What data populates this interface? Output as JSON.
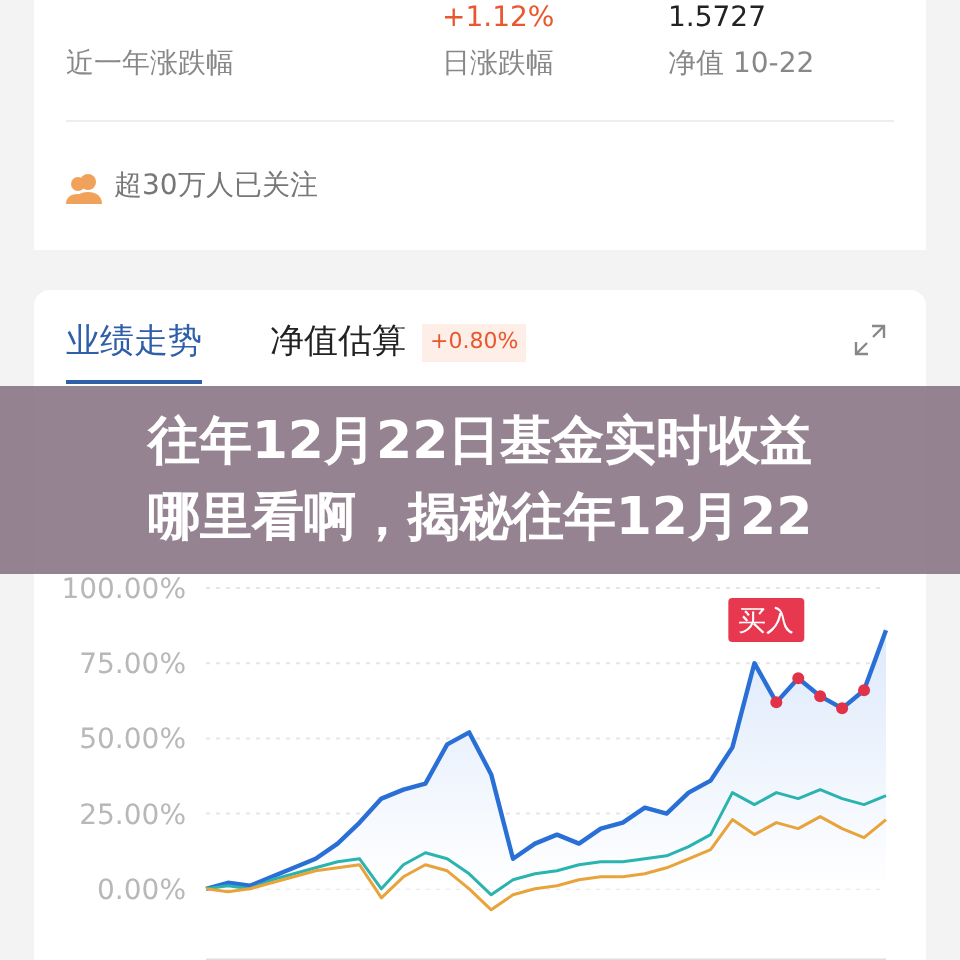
{
  "summary": {
    "stats": [
      {
        "value": "+1.12%",
        "label": "日涨跌幅"
      },
      {
        "value": "1.5727",
        "label": "净值 10-22"
      }
    ],
    "first_label": "近一年涨跌幅",
    "followers": "超30万人已关注"
  },
  "tabs": [
    {
      "label": "业绩走势",
      "selected": true
    },
    {
      "label": "净值估算",
      "selected": false,
      "badge": "+0.80%"
    }
  ],
  "banner": {
    "lines": [
      "往年12月22日基金实时收益",
      "哪里看啊，揭秘往年12月22"
    ]
  },
  "chart_data": {
    "type": "line",
    "grid": true,
    "ylim": [
      -25,
      100
    ],
    "yticks": [
      {
        "value": 100,
        "label": "100.00%"
      },
      {
        "value": 75,
        "label": "75.00%"
      },
      {
        "value": 50,
        "label": "50.00%"
      },
      {
        "value": 25,
        "label": "25.00%"
      },
      {
        "value": 0,
        "label": "0.00%"
      }
    ],
    "series": [
      {
        "type": "area",
        "color": "#2a6fd6",
        "values": [
          0,
          2,
          1,
          4,
          7,
          10,
          15,
          22,
          30,
          33,
          35,
          48,
          52,
          38,
          10,
          15,
          18,
          15,
          20,
          22,
          27,
          25,
          32,
          36,
          47,
          75,
          62,
          70,
          64,
          60,
          66,
          86
        ]
      },
      {
        "type": "line",
        "color": "#2bb3b0",
        "values": [
          0,
          1,
          0,
          3,
          5,
          7,
          9,
          10,
          0,
          8,
          12,
          10,
          5,
          -2,
          3,
          5,
          6,
          8,
          9,
          9,
          10,
          11,
          14,
          18,
          32,
          28,
          32,
          30,
          33,
          30,
          28,
          31
        ]
      },
      {
        "type": "line",
        "color": "#e8a33a",
        "values": [
          0,
          -1,
          0,
          2,
          4,
          6,
          7,
          8,
          -3,
          4,
          8,
          6,
          0,
          -7,
          -2,
          0,
          1,
          3,
          4,
          4,
          5,
          7,
          10,
          13,
          23,
          18,
          22,
          20,
          24,
          20,
          17,
          23
        ]
      },
      {
        "type": "scatter",
        "color": "#e0334a",
        "values": [
          null,
          null,
          null,
          null,
          null,
          null,
          null,
          null,
          null,
          null,
          null,
          null,
          null,
          null,
          null,
          null,
          null,
          null,
          null,
          null,
          null,
          null,
          null,
          null,
          null,
          null,
          62,
          70,
          64,
          60,
          66,
          null
        ]
      }
    ],
    "annotations": [
      "买入"
    ]
  }
}
